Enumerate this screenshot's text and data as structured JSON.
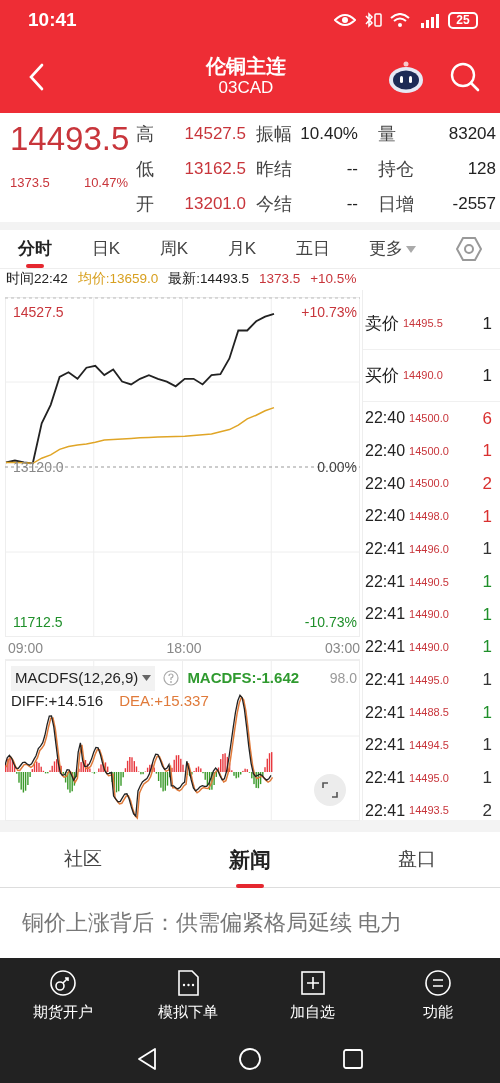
{
  "status_bar": {
    "time": "10:41",
    "battery": "25"
  },
  "header": {
    "title": "伦铜主连",
    "code": "03CAD"
  },
  "quote": {
    "price": "14493.5",
    "change": "1373.5",
    "change_pct": "10.47%",
    "stats": [
      {
        "label": "高",
        "value": "14527.5",
        "color": "#c8353b"
      },
      {
        "label": "振幅",
        "value": "10.40%",
        "color": "#222222"
      },
      {
        "label": "量",
        "value": "83204",
        "color": "#222222"
      },
      {
        "label": "低",
        "value": "13162.5",
        "color": "#c8353b"
      },
      {
        "label": "昨结",
        "value": "--",
        "color": "#222222"
      },
      {
        "label": "持仓",
        "value": "128",
        "color": "#222222"
      },
      {
        "label": "开",
        "value": "13201.0",
        "color": "#c8353b"
      },
      {
        "label": "今结",
        "value": "--",
        "color": "#222222"
      },
      {
        "label": "日增",
        "value": "-2557",
        "color": "#222222"
      }
    ]
  },
  "chart_tabs": [
    {
      "label": "分时",
      "selected": true,
      "kind": "tab"
    },
    {
      "label": "日K",
      "selected": false,
      "kind": "tab"
    },
    {
      "label": "周K",
      "selected": false,
      "kind": "tab"
    },
    {
      "label": "月K",
      "selected": false,
      "kind": "tab"
    },
    {
      "label": "五日",
      "selected": false,
      "kind": "tab"
    },
    {
      "label": "更多",
      "selected": false,
      "kind": "dropdown"
    }
  ],
  "info_line": {
    "time": "时间22:42",
    "avg": "均价:13659.0",
    "last": "最新:14493.5",
    "change": "1373.5",
    "change_pct": "+10.5%"
  },
  "price_chart": {
    "right_labels": [
      "+10.73%",
      "0.00%",
      "-10.73%"
    ],
    "x_labels": [
      "09:00",
      "18:00",
      "03:00"
    ],
    "chart_data": {
      "type": "line",
      "categories": [
        null,
        null,
        null,
        null,
        null,
        null,
        null,
        null,
        null,
        null,
        null,
        null,
        null,
        null,
        null,
        null,
        null,
        null,
        null,
        null,
        null,
        null,
        null,
        null,
        null,
        null,
        null,
        null,
        null,
        null,
        null
      ],
      "series": [
        {
          "color": "#222222",
          "values": [
            13162,
            13179,
            13162,
            13154,
            13516,
            13685,
            13938,
            13980,
            13921,
            14022,
            14039,
            13954,
            14005,
            13895,
            13870,
            13921,
            13954,
            13921,
            13895,
            13853,
            13921,
            13921,
            13870,
            13954,
            13963,
            14106,
            14359,
            14359,
            14443,
            14485,
            14511
          ]
        },
        {
          "color": "#e0a526",
          "values": [
            13162,
            13160,
            13158,
            13154,
            13200,
            13230,
            13280,
            13305,
            13320,
            13330,
            13345,
            13364,
            13370,
            13375,
            13380,
            13385,
            13389,
            13392,
            13395,
            13397,
            13400,
            13406,
            13412,
            13420,
            13440,
            13460,
            13500,
            13558,
            13590,
            13630,
            13659
          ]
        }
      ],
      "ylim": [
        11576.5,
        14663.5
      ],
      "yticks": [
        {
          "value": 14527.5,
          "label": "14527.5"
        },
        {
          "value": 13120,
          "label": "13120.0"
        },
        {
          "value": 11712.5,
          "label": "11712.5"
        }
      ]
    }
  },
  "order_book": [
    {
      "label": "卖价",
      "price": "14495.5",
      "volume": "1"
    },
    {
      "label": "买价",
      "price": "14490.0",
      "volume": "1"
    }
  ],
  "trades": [
    {
      "time": "22:40",
      "price": "14500.0",
      "volume": "6",
      "color": "#d9302f"
    },
    {
      "time": "22:40",
      "price": "14500.0",
      "volume": "1",
      "color": "#d9302f"
    },
    {
      "time": "22:40",
      "price": "14500.0",
      "volume": "2",
      "color": "#d9302f"
    },
    {
      "time": "22:40",
      "price": "14498.0",
      "volume": "1",
      "color": "#d9302f"
    },
    {
      "time": "22:41",
      "price": "14496.0",
      "volume": "1",
      "color": "#333333"
    },
    {
      "time": "22:41",
      "price": "14490.5",
      "volume": "1",
      "color": "#1f8f2a"
    },
    {
      "time": "22:41",
      "price": "14490.0",
      "volume": "1",
      "color": "#1f8f2a"
    },
    {
      "time": "22:41",
      "price": "14490.0",
      "volume": "1",
      "color": "#1f8f2a"
    },
    {
      "time": "22:41",
      "price": "14495.0",
      "volume": "1",
      "color": "#333333"
    },
    {
      "time": "22:41",
      "price": "14488.5",
      "volume": "1",
      "color": "#1f8f2a"
    },
    {
      "time": "22:41",
      "price": "14494.5",
      "volume": "1",
      "color": "#333333"
    },
    {
      "time": "22:41",
      "price": "14495.0",
      "volume": "1",
      "color": "#333333"
    },
    {
      "time": "22:41",
      "price": "14493.5",
      "volume": "2",
      "color": "#333333"
    }
  ],
  "macd": {
    "indicator": "MACDFS(12,26,9)",
    "value": "MACDFS:-1.642",
    "top_label": "98.0",
    "diff": "DIFF:+14.516",
    "dea": "DEA:+15.337"
  },
  "bottom_tabs": [
    {
      "label": "社区",
      "selected": false
    },
    {
      "label": "新闻",
      "selected": true
    },
    {
      "label": "盘口",
      "selected": false
    }
  ],
  "news": [
    {
      "title": "铜价上涨背后：供需偏紧格局延续 电力"
    }
  ],
  "actions": [
    {
      "label": "期货开户",
      "kind": "account"
    },
    {
      "label": "模拟下单",
      "kind": "order"
    },
    {
      "label": "加自选",
      "kind": "add"
    },
    {
      "label": "功能",
      "kind": "menu"
    }
  ]
}
